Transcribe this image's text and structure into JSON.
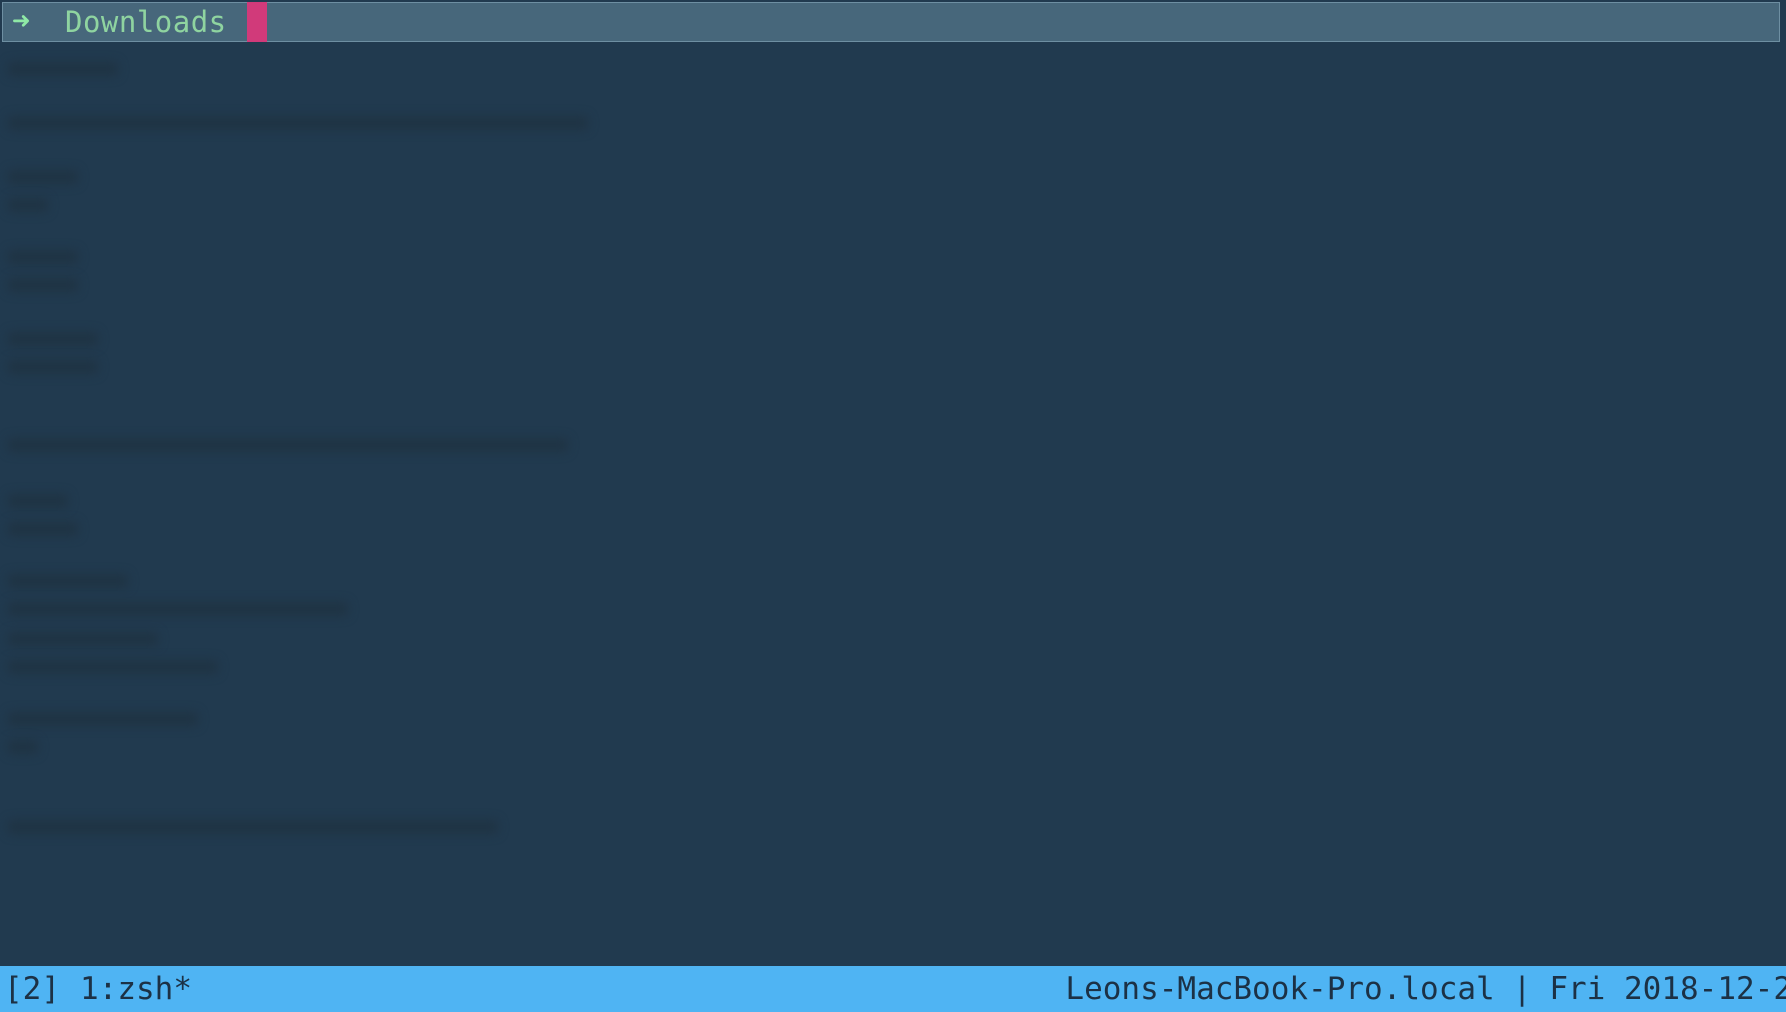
{
  "prompt": {
    "arrow_icon": "right-arrow-icon",
    "directory": "Downloads"
  },
  "statusbar": {
    "session": "[2]",
    "window": "1:zsh*",
    "hostname": "Leons-MacBook-Pro.local",
    "separator": "|",
    "datetime": "Fri 2018-12-2"
  },
  "colors": {
    "background": "#213a4f",
    "prompt_bar": "#47677b",
    "prompt_text": "#8fd4a0",
    "cursor": "#d13a7a",
    "statusbar": "#4fb4f3",
    "statusbar_text": "#1c3145"
  }
}
